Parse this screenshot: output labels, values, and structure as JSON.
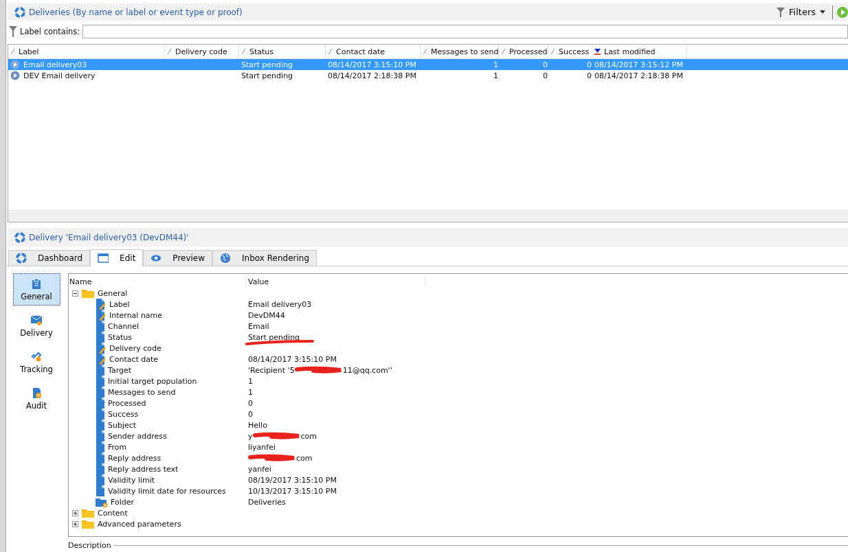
{
  "list_panel": {
    "title": "Deliveries (By name or label or event type or proof)",
    "filters_button": "Filters",
    "filter_label": "Label contains:"
  },
  "table": {
    "columns": [
      {
        "label": "Label",
        "sorted": false
      },
      {
        "label": "Delivery code",
        "sorted": false
      },
      {
        "label": "Status",
        "sorted": false
      },
      {
        "label": "Contact date",
        "sorted": false
      },
      {
        "label": "Messages to send",
        "sorted": false
      },
      {
        "label": "Processed",
        "sorted": false
      },
      {
        "label": "Success",
        "sorted": false
      },
      {
        "label": "Last modified",
        "sorted": true
      }
    ],
    "rows": [
      {
        "selected": true,
        "cells": [
          "Email delivery03",
          "",
          "Start pending",
          "08/14/2017 3:15:10 PM",
          "1",
          "0",
          "0",
          "08/14/2017 3:15:12 PM"
        ]
      },
      {
        "selected": false,
        "cells": [
          "DEV Email delivery",
          "",
          "Start pending",
          "08/14/2017 2:18:38 PM",
          "1",
          "0",
          "0",
          "08/14/2017 2:18:38 PM"
        ]
      }
    ]
  },
  "detail": {
    "title": "Delivery 'Email delivery03 (DevDM44)'",
    "tabs": [
      {
        "label": "Dashboard",
        "selected": false
      },
      {
        "label": "Edit",
        "selected": true
      },
      {
        "label": "Preview",
        "selected": false
      },
      {
        "label": "Inbox Rendering",
        "selected": false
      }
    ],
    "nav": [
      {
        "label": "General",
        "selected": true
      },
      {
        "label": "Delivery",
        "selected": false
      },
      {
        "label": "Tracking",
        "selected": false
      },
      {
        "label": "Audit",
        "selected": false
      }
    ],
    "tree_columns": [
      "Name",
      "Value"
    ],
    "tree": [
      {
        "name": "General",
        "expanded": true,
        "children": [
          {
            "name": "Label",
            "kind": "editable",
            "value": "Email delivery03"
          },
          {
            "name": "Internal name",
            "kind": "editable",
            "value": "DevDM44"
          },
          {
            "name": "Channel",
            "kind": "field",
            "value": "Email"
          },
          {
            "name": "Status",
            "kind": "field",
            "value": "Start pending",
            "underlined": true
          },
          {
            "name": "Delivery code",
            "kind": "editable"
          },
          {
            "name": "Contact date",
            "kind": "editable",
            "value": "08/14/2017 3:15:10 PM"
          },
          {
            "name": "Target",
            "kind": "field",
            "value": "'Recipient '5",
            "value_after": "11@qq.com''"
          },
          {
            "name": "Initial target population",
            "kind": "field",
            "value": "1"
          },
          {
            "name": "Messages to send",
            "kind": "field",
            "value": "1"
          },
          {
            "name": "Processed",
            "kind": "field",
            "value": "0"
          },
          {
            "name": "Success",
            "kind": "field",
            "value": "0"
          },
          {
            "name": "Subject",
            "kind": "field",
            "value": "Hello"
          },
          {
            "name": "Sender address",
            "kind": "field",
            "value": "y",
            "value_after": "com"
          },
          {
            "name": "From",
            "kind": "field",
            "value": "liyanfei"
          },
          {
            "name": "Reply address",
            "kind": "field",
            "value_after": "com"
          },
          {
            "name": "Reply address text",
            "kind": "field",
            "value": "yanfei"
          },
          {
            "name": "Validity limit",
            "kind": "field",
            "value": "08/19/2017 3:15:10 PM"
          },
          {
            "name": "Validity limit date for resources",
            "kind": "field",
            "value": "10/13/2017 3:15:10 PM"
          },
          {
            "name": "Folder",
            "kind": "folder-link",
            "value": "Deliveries"
          }
        ]
      },
      {
        "name": "Content",
        "expanded": false
      },
      {
        "name": "Advanced parameters",
        "expanded": false
      }
    ],
    "description_label": "Description"
  }
}
